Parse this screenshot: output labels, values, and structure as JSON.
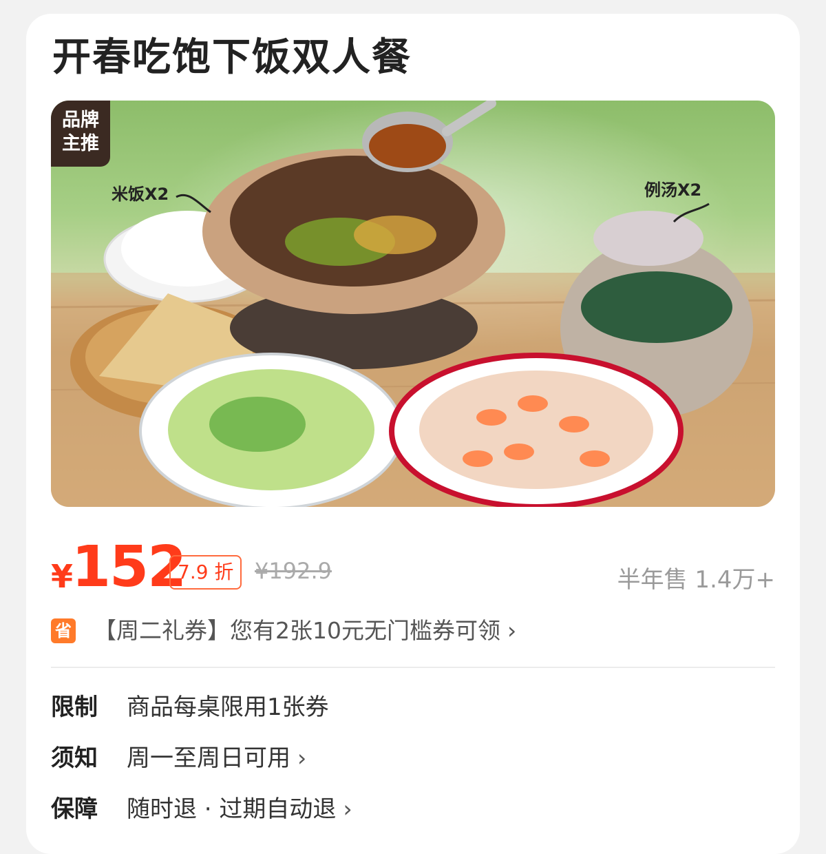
{
  "product": {
    "title": "开春吃饱下饭双人餐"
  },
  "hero": {
    "badge_line1": "品牌",
    "badge_line2": "主推",
    "callout_rice": "米饭X2",
    "callout_soup": "例汤X2"
  },
  "pricing": {
    "currency": "¥",
    "price": "152",
    "discount": "7.9 折",
    "original": "¥192.9",
    "sales": "半年售 1.4万+"
  },
  "coupon": {
    "icon_text": "省",
    "text": "【周二礼券】您有2张10元无门槛券可领"
  },
  "info": [
    {
      "label": "限制",
      "value": "商品每桌限用1张券"
    },
    {
      "label": "须知",
      "value": "周一至周日可用"
    },
    {
      "label": "保障",
      "value": "随时退 · 过期自动退"
    }
  ],
  "colors": {
    "accent": "#ff3b1a",
    "badge_bg": "#3b2a22",
    "save_icon": "#ff7a2a"
  }
}
